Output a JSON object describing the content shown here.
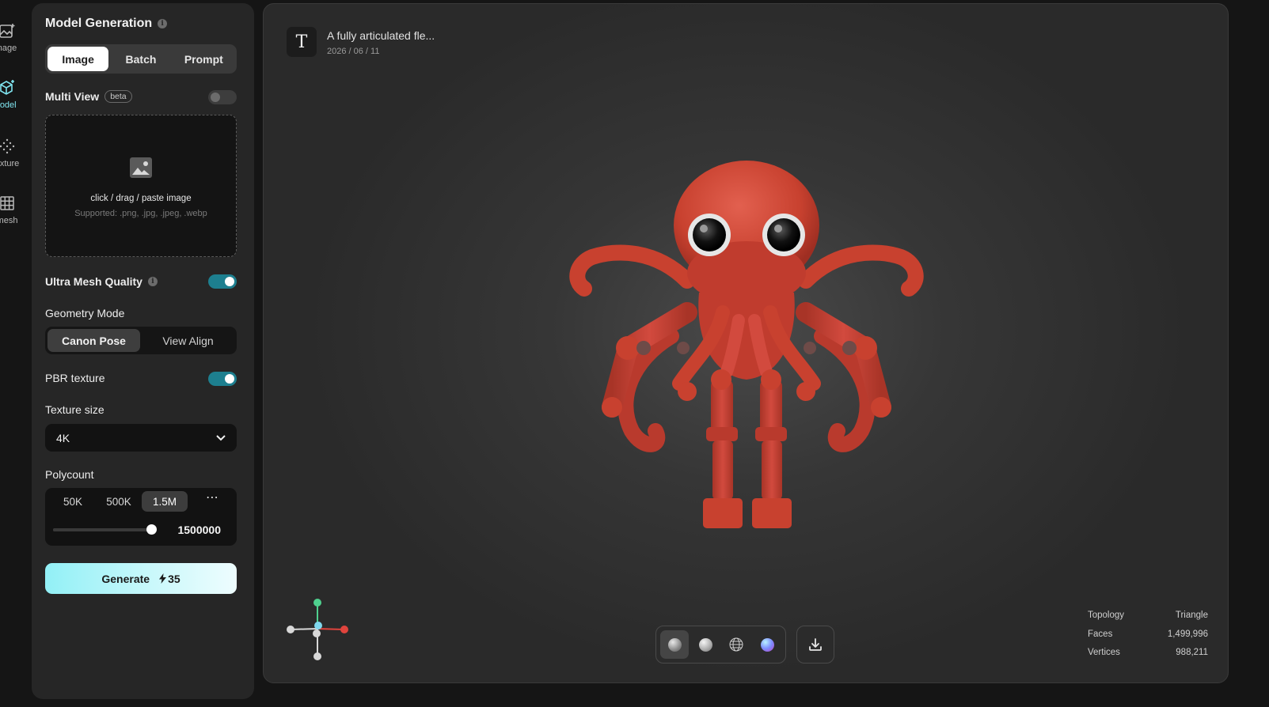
{
  "rail": {
    "items": [
      {
        "label": "nage",
        "icon": "image-sparkle-icon"
      },
      {
        "label": "lodel",
        "icon": "cube-sparkle-icon"
      },
      {
        "label": "exture",
        "icon": "texture-dots-icon"
      },
      {
        "label": "mesh",
        "icon": "grid-icon"
      }
    ]
  },
  "panel": {
    "title": "Model Generation",
    "tabs": [
      "Image",
      "Batch",
      "Prompt"
    ],
    "selected_tab": "Image",
    "multi_view": {
      "label": "Multi View",
      "badge": "beta",
      "enabled": false
    },
    "dropzone": {
      "main": "click / drag / paste image",
      "sub": "Supported: .png, .jpg, .jpeg, .webp"
    },
    "ultra_mesh": {
      "label": "Ultra Mesh Quality",
      "enabled": true
    },
    "geometry": {
      "label": "Geometry Mode",
      "options": [
        "Canon Pose",
        "View Align"
      ],
      "selected": "Canon Pose"
    },
    "pbr": {
      "label": "PBR texture",
      "enabled": true
    },
    "texture_size": {
      "label": "Texture size",
      "value": "4K"
    },
    "polycount": {
      "label": "Polycount",
      "options": [
        "50K",
        "500K",
        "1.5M"
      ],
      "selected": "1.5M",
      "more": "⋯",
      "value": "1500000",
      "slider_fraction": 1.0
    },
    "generate": {
      "label": "Generate",
      "cost": "35"
    }
  },
  "viewport": {
    "task_icon": "T",
    "task_title": "A fully articulated fle...",
    "task_date": "2026 / 06 / 11",
    "render_modes": [
      "clay-mode",
      "matte-mode",
      "wireframe-mode",
      "normal-mode"
    ],
    "selected_render_mode": "clay-mode",
    "stats": [
      {
        "label": "Topology",
        "value": "Triangle"
      },
      {
        "label": "Faces",
        "value": "1,499,996"
      },
      {
        "label": "Vertices",
        "value": "988,211"
      }
    ]
  },
  "colors": {
    "accent": "#1d7f8f",
    "generate_gradient_start": "#92f0f6",
    "model": "#d24a3e"
  }
}
